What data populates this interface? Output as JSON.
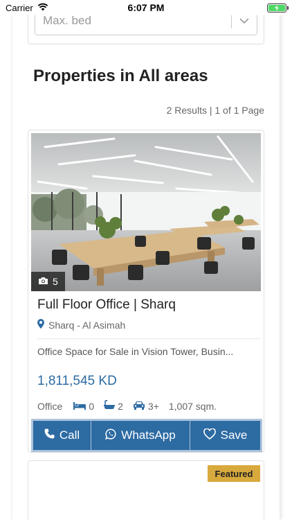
{
  "status_bar": {
    "carrier": "Carrier",
    "time": "6:07 PM"
  },
  "filter": {
    "max_bed_placeholder": "Max. bed"
  },
  "listing": {
    "heading": "Properties in All areas",
    "results_info": "2 Results | 1 of 1 Page"
  },
  "property": {
    "photo_count": "5",
    "title": "Full Floor Office | Sharq",
    "location": "Sharq - Al Asimah",
    "description": "Office Space for Sale in Vision Tower, Busin...",
    "price": "1,811,545 KD",
    "type": "Office",
    "beds": "0",
    "baths": "2",
    "parking": "3+",
    "area": "1,007 sqm."
  },
  "actions": {
    "call_label": "Call",
    "whatsapp_label": "WhatsApp",
    "save_label": "Save"
  },
  "second_card": {
    "badge": "Featured"
  },
  "colors": {
    "accent": "#2d6ba3",
    "featured": "#d8a93c",
    "battery": "#4cd964"
  },
  "icons": [
    "wifi-icon",
    "battery-icon",
    "chevron-down-icon",
    "camera-icon",
    "map-pin-icon",
    "bed-icon",
    "bath-icon",
    "car-icon",
    "phone-icon",
    "whatsapp-icon",
    "heart-icon"
  ]
}
